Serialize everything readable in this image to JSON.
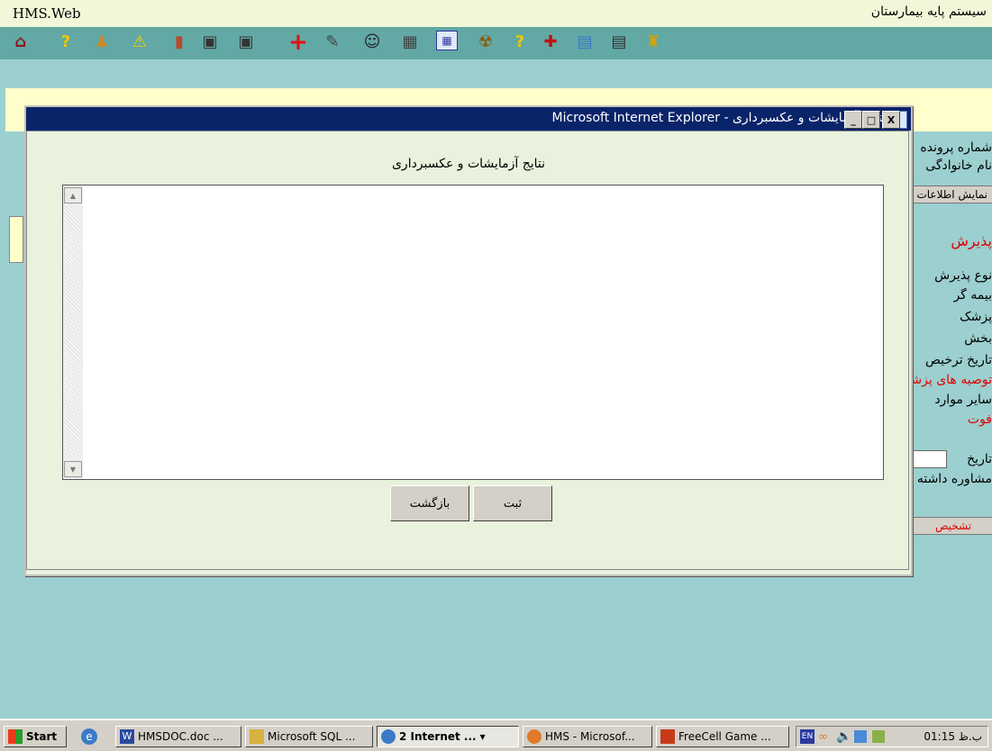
{
  "header": {
    "brand": "HMS.Web",
    "title": "سیستم پایه بیمارستان"
  },
  "toolbar_icons": [
    "house-icon",
    "help-icon",
    "users-icon",
    "warning-icon",
    "exit-door-icon",
    "network-computers-icon",
    "computer-icon",
    "red-cross-icon",
    "edit-document-icon",
    "nurse-icon",
    "equipment-icon",
    "calendar-grid-icon",
    "radiation-icon",
    "help-icon-2",
    "first-aid-kit-icon",
    "records-icon",
    "report-icon",
    "drink-icon"
  ],
  "background_page": {
    "file_number_label": "شماره پرونده",
    "family_name_label": "نام خانوادگی",
    "show_info_button": "نمایش اطلاعات",
    "admission_heading": "پذیرش",
    "admission_type_label": "نوع پذیرش",
    "insurer_label": "بیمه گر",
    "doctor_label": "پزشک",
    "ward_label": "بخش",
    "discharge_date_label": "تاریخ ترخیص",
    "recommendations_label": "توصیه های پزشک",
    "other_items_label": "سایر موارد",
    "death_label": "فوت",
    "date_label": "تاریخ",
    "consultation_label": "مشاوره داشته",
    "diagnosis_button": "تشخیص"
  },
  "dialog": {
    "title": "نتایج آزمایشات و عکسبرداری - Microsoft Internet Explorer",
    "heading": "نتایج آزمایشات و عکسبرداری",
    "results_text": "",
    "submit_button": "ثبت",
    "back_button": "بازگشت",
    "minimize": "_",
    "maximize": "□",
    "close": "X"
  },
  "taskbar": {
    "start": "Start",
    "tasks": [
      "HMSDOC.doc ...",
      "Microsoft SQL ...",
      "2 Internet ...",
      "HMS - Microsof...",
      "FreeCell Game ..."
    ],
    "language": "EN",
    "clock": "01:15 ب.ظ"
  },
  "colors": {
    "header_bg": "#f2f7d9",
    "toolbar_bg": "#62a8a4",
    "page_bg": "#9ccfcf",
    "titlebar": "#0a246a",
    "accent_red": "#e00000"
  }
}
